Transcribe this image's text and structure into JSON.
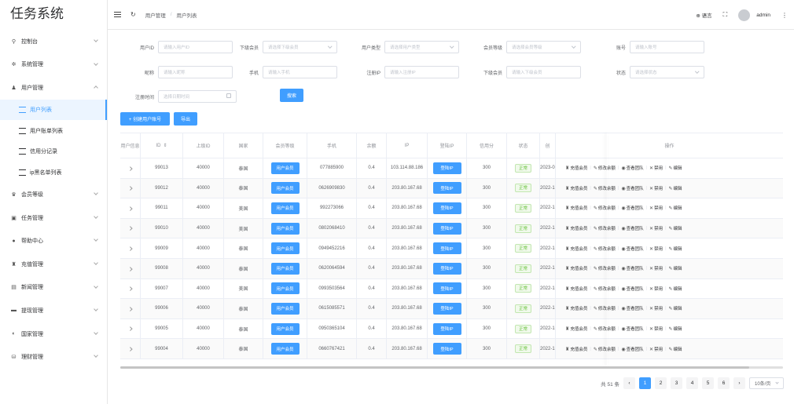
{
  "app": {
    "title": "任务系统"
  },
  "sidebar": {
    "items": [
      {
        "label": "控制台",
        "icon": "dashboard-icon"
      },
      {
        "label": "系统管理",
        "icon": "gear-icon"
      },
      {
        "label": "用户管理",
        "icon": "user-icon",
        "expanded": true,
        "children": [
          {
            "label": "用户列表",
            "active": true
          },
          {
            "label": "用户账单列表"
          },
          {
            "label": "信用分记录"
          },
          {
            "label": "ip黑名单列表"
          }
        ]
      },
      {
        "label": "会员等级",
        "icon": "crown-icon"
      },
      {
        "label": "任务管理",
        "icon": "task-icon"
      },
      {
        "label": "帮助中心",
        "icon": "help-icon"
      },
      {
        "label": "充值管理",
        "icon": "recharge-icon"
      },
      {
        "label": "新闻管理",
        "icon": "news-icon"
      },
      {
        "label": "提现管理",
        "icon": "wallet-icon"
      },
      {
        "label": "国家管理",
        "icon": "globe-icon"
      },
      {
        "label": "理财管理",
        "icon": "finance-icon"
      }
    ]
  },
  "header": {
    "breadcrumb": [
      "用户管理",
      "用户列表"
    ],
    "lang": "语言",
    "user": "admin"
  },
  "filters": {
    "row1": [
      {
        "label": "用户ID",
        "placeholder": "请输入用户ID",
        "select": false
      },
      {
        "label": "下级会员",
        "placeholder": "请选择下级会员",
        "select": true
      },
      {
        "label": "用户类型",
        "placeholder": "请选择用户类型",
        "select": true
      },
      {
        "label": "会员等级",
        "placeholder": "请选择会员等级",
        "select": true
      },
      {
        "label": "账号",
        "placeholder": "请输入账号",
        "select": false
      }
    ],
    "row2": [
      {
        "label": "昵称",
        "placeholder": "请输入昵称",
        "select": false
      },
      {
        "label": "手机",
        "placeholder": "请输入手机",
        "select": false
      },
      {
        "label": "注册IP",
        "placeholder": "请输入注册IP",
        "select": false
      },
      {
        "label": "下级会员",
        "placeholder": "请输入下级会员",
        "select": false
      },
      {
        "label": "状态",
        "placeholder": "请选择状态",
        "select": true
      }
    ],
    "date": {
      "label": "注册时间",
      "placeholder": "选择日期时间"
    },
    "search_label": "搜索"
  },
  "toolbar": {
    "create_label": "+ 创建用户账号",
    "export_label": "导出"
  },
  "table": {
    "headers": [
      "用户信息",
      "ID",
      "上级ID",
      "国家",
      "会员等级",
      "手机",
      "余额",
      "IP",
      "登陆IP",
      "信用分",
      "状态",
      "创",
      "操作"
    ],
    "level_label": "用户会员",
    "login_ip_label": "登陆IP",
    "status_label": "正常",
    "ops": [
      "充值会员",
      "修改余额",
      "查看团队",
      "禁用",
      "编辑"
    ],
    "rows": [
      {
        "id": "99013",
        "parent": "40000",
        "country": "泰国",
        "phone": "077885900",
        "balance": "0.4",
        "ip": "103.114.88.186",
        "credit": "300",
        "created": "2023-0"
      },
      {
        "id": "99012",
        "parent": "40000",
        "country": "泰国",
        "phone": "0626909830",
        "balance": "0.4",
        "ip": "203.80.167.68",
        "credit": "300",
        "created": "2022-1"
      },
      {
        "id": "99011",
        "parent": "40000",
        "country": "美国",
        "phone": "992273066",
        "balance": "0.4",
        "ip": "203.80.167.68",
        "credit": "300",
        "created": "2022-1"
      },
      {
        "id": "99010",
        "parent": "40000",
        "country": "美国",
        "phone": "0802068410",
        "balance": "0.4",
        "ip": "203.80.167.68",
        "credit": "300",
        "created": "2022-1"
      },
      {
        "id": "99009",
        "parent": "40000",
        "country": "泰国",
        "phone": "0949452216",
        "balance": "0.4",
        "ip": "203.80.167.68",
        "credit": "300",
        "created": "2022-1"
      },
      {
        "id": "99008",
        "parent": "40000",
        "country": "泰国",
        "phone": "0620064594",
        "balance": "0.4",
        "ip": "203.80.167.68",
        "credit": "300",
        "created": "2022-1"
      },
      {
        "id": "99007",
        "parent": "40000",
        "country": "美国",
        "phone": "0993503564",
        "balance": "0.4",
        "ip": "203.80.167.68",
        "credit": "300",
        "created": "2022-1"
      },
      {
        "id": "99006",
        "parent": "40000",
        "country": "泰国",
        "phone": "0615085571",
        "balance": "0.4",
        "ip": "203.80.167.68",
        "credit": "300",
        "created": "2022-1"
      },
      {
        "id": "99005",
        "parent": "40000",
        "country": "泰国",
        "phone": "0950365104",
        "balance": "0.4",
        "ip": "203.80.167.68",
        "credit": "300",
        "created": "2022-1"
      },
      {
        "id": "99004",
        "parent": "40000",
        "country": "泰国",
        "phone": "0660767421",
        "balance": "0.4",
        "ip": "203.80.167.68",
        "credit": "300",
        "created": "2022-1"
      }
    ]
  },
  "pagination": {
    "total": "共 51 条",
    "pages": [
      "1",
      "2",
      "3",
      "4",
      "5",
      "6"
    ],
    "current": "1",
    "page_size": "10条/页"
  },
  "colors": {
    "primary": "#409eff",
    "success": "#67c23a",
    "sidebar_active_bg": "#ecf5ff"
  }
}
